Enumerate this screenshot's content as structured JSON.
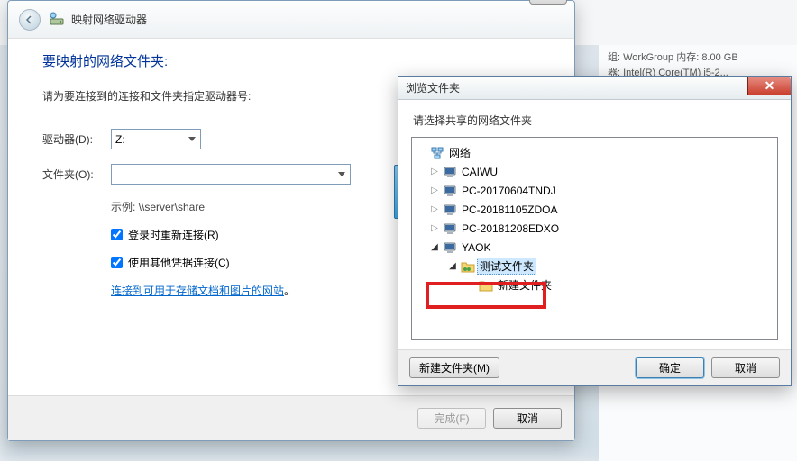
{
  "bg": {
    "line1": "组: WorkGroup    内存: 8.00 GB",
    "line2": "器: Intel(R) Core(TM) i5-2..."
  },
  "dlg1": {
    "window_title": "映射网络驱动器",
    "close_glyph": "✕",
    "heading": "要映射的网络文件夹:",
    "subtitle": "请为要连接到的连接和文件夹指定驱动器号:",
    "drive_label": "驱动器(D):",
    "drive_value": "Z:",
    "folder_label": "文件夹(O):",
    "folder_value": "",
    "example": "示例: \\\\server\\share",
    "reconnect": "登录时重新连接(R)",
    "other_cred": "使用其他凭据连接(C)",
    "link_text": "连接到可用于存储文档和图片的网站",
    "finish": "完成(F)",
    "cancel": "取消"
  },
  "dlg2": {
    "window_title": "浏览文件夹",
    "prompt": "请选择共享的网络文件夹",
    "btn_new": "新建文件夹(M)",
    "btn_ok": "确定",
    "btn_cancel": "取消",
    "tree": {
      "root": "网络",
      "items": [
        "CAIWU",
        "PC-20170604TNDJ",
        "PC-20181105ZDOA",
        "PC-20181208EDXO",
        "YAOK"
      ],
      "sel": "测试文件夹",
      "sibling": "新建文件夹"
    }
  }
}
